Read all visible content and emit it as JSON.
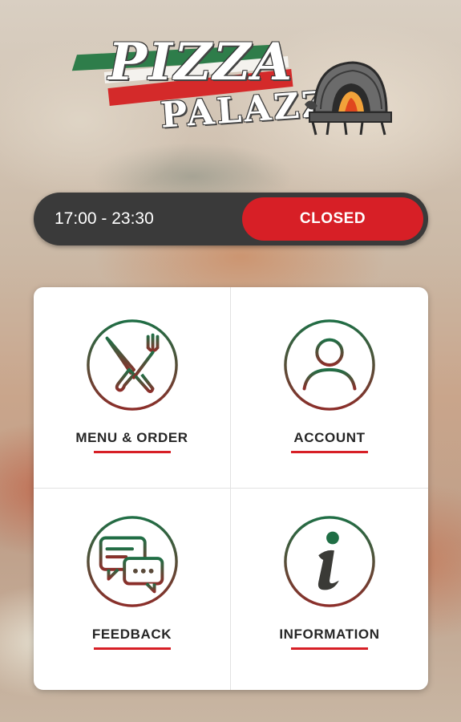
{
  "brand": {
    "line1": "PIZZA",
    "line2": "PALAZZO",
    "colors": {
      "green": "#2e7d4a",
      "red": "#d42a2a"
    },
    "logo_icon": "pizza-oven-icon"
  },
  "hours": {
    "time_range": "17:00 - 23:30",
    "status": "CLOSED",
    "status_color": "#d71f26"
  },
  "menu": {
    "tiles": [
      {
        "label": "MENU & ORDER",
        "icon": "fork-knife-icon"
      },
      {
        "label": "ACCOUNT",
        "icon": "user-icon"
      },
      {
        "label": "FEEDBACK",
        "icon": "chat-bubbles-icon"
      },
      {
        "label": "INFORMATION",
        "icon": "info-icon"
      }
    ],
    "accent": "#d71f26",
    "icon_gradient": [
      "#1f6e45",
      "#8c2e2a"
    ]
  }
}
